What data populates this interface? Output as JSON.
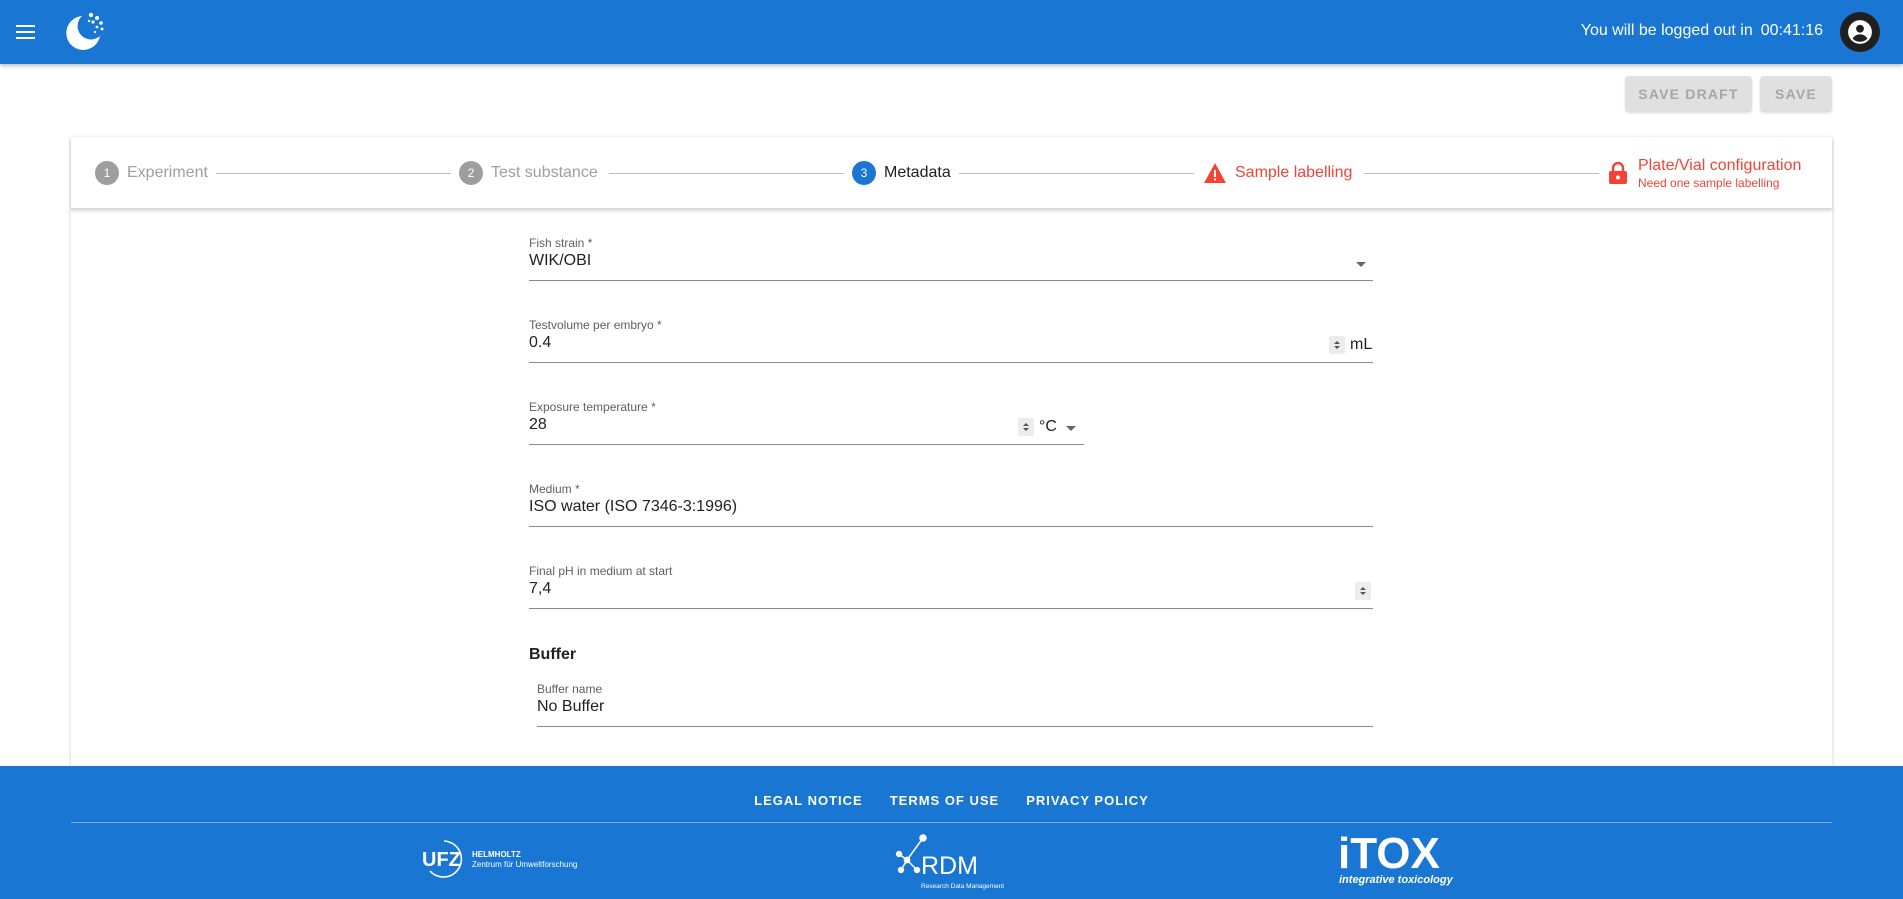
{
  "header": {
    "logout_label": "You will be logged out in",
    "logout_timer": "00:41:16"
  },
  "toolbar": {
    "save_draft_label": "SAVE DRAFT",
    "save_label": "SAVE"
  },
  "stepper": {
    "steps": [
      {
        "number": "1",
        "label": "Experiment",
        "state": "inactive"
      },
      {
        "number": "2",
        "label": "Test substance",
        "state": "inactive"
      },
      {
        "number": "3",
        "label": "Metadata",
        "state": "active"
      },
      {
        "label": "Sample labelling",
        "state": "error",
        "icon": "warning-icon"
      },
      {
        "label": "Plate/Vial configuration",
        "sublabel": "Need one sample labelling",
        "state": "error",
        "icon": "lock-icon"
      }
    ]
  },
  "form": {
    "fish_strain": {
      "label": "Fish strain *",
      "value": "WIK/OBI"
    },
    "testvolume": {
      "label": "Testvolume per embryo *",
      "value": "0.4",
      "unit": "mL"
    },
    "exposure_temperature": {
      "label": "Exposure temperature *",
      "value": "28",
      "unit": "°C"
    },
    "medium": {
      "label": "Medium *",
      "value": "ISO water (ISO 7346-3:1996)"
    },
    "final_ph": {
      "label": "Final pH in medium at start",
      "value": "7,4"
    },
    "buffer_section": "Buffer",
    "buffer_name": {
      "label": "Buffer name",
      "value": "No Buffer"
    }
  },
  "footer": {
    "links": [
      "LEGAL NOTICE",
      "TERMS OF USE",
      "PRIVACY POLICY"
    ],
    "ufz_logo": {
      "mark": "UFZ",
      "line1": "HELMHOLTZ",
      "line2": "Zentrum für Umweltforschung"
    },
    "rdm_logo": {
      "mark": "RDM",
      "tagline": "Research Data Management"
    },
    "itox_logo": {
      "mark": "iTOX",
      "tagline": "integrative toxicology"
    }
  },
  "colors": {
    "primary": "#1976d2",
    "error": "#f44336",
    "disabled_button": "#e0e0e0"
  }
}
